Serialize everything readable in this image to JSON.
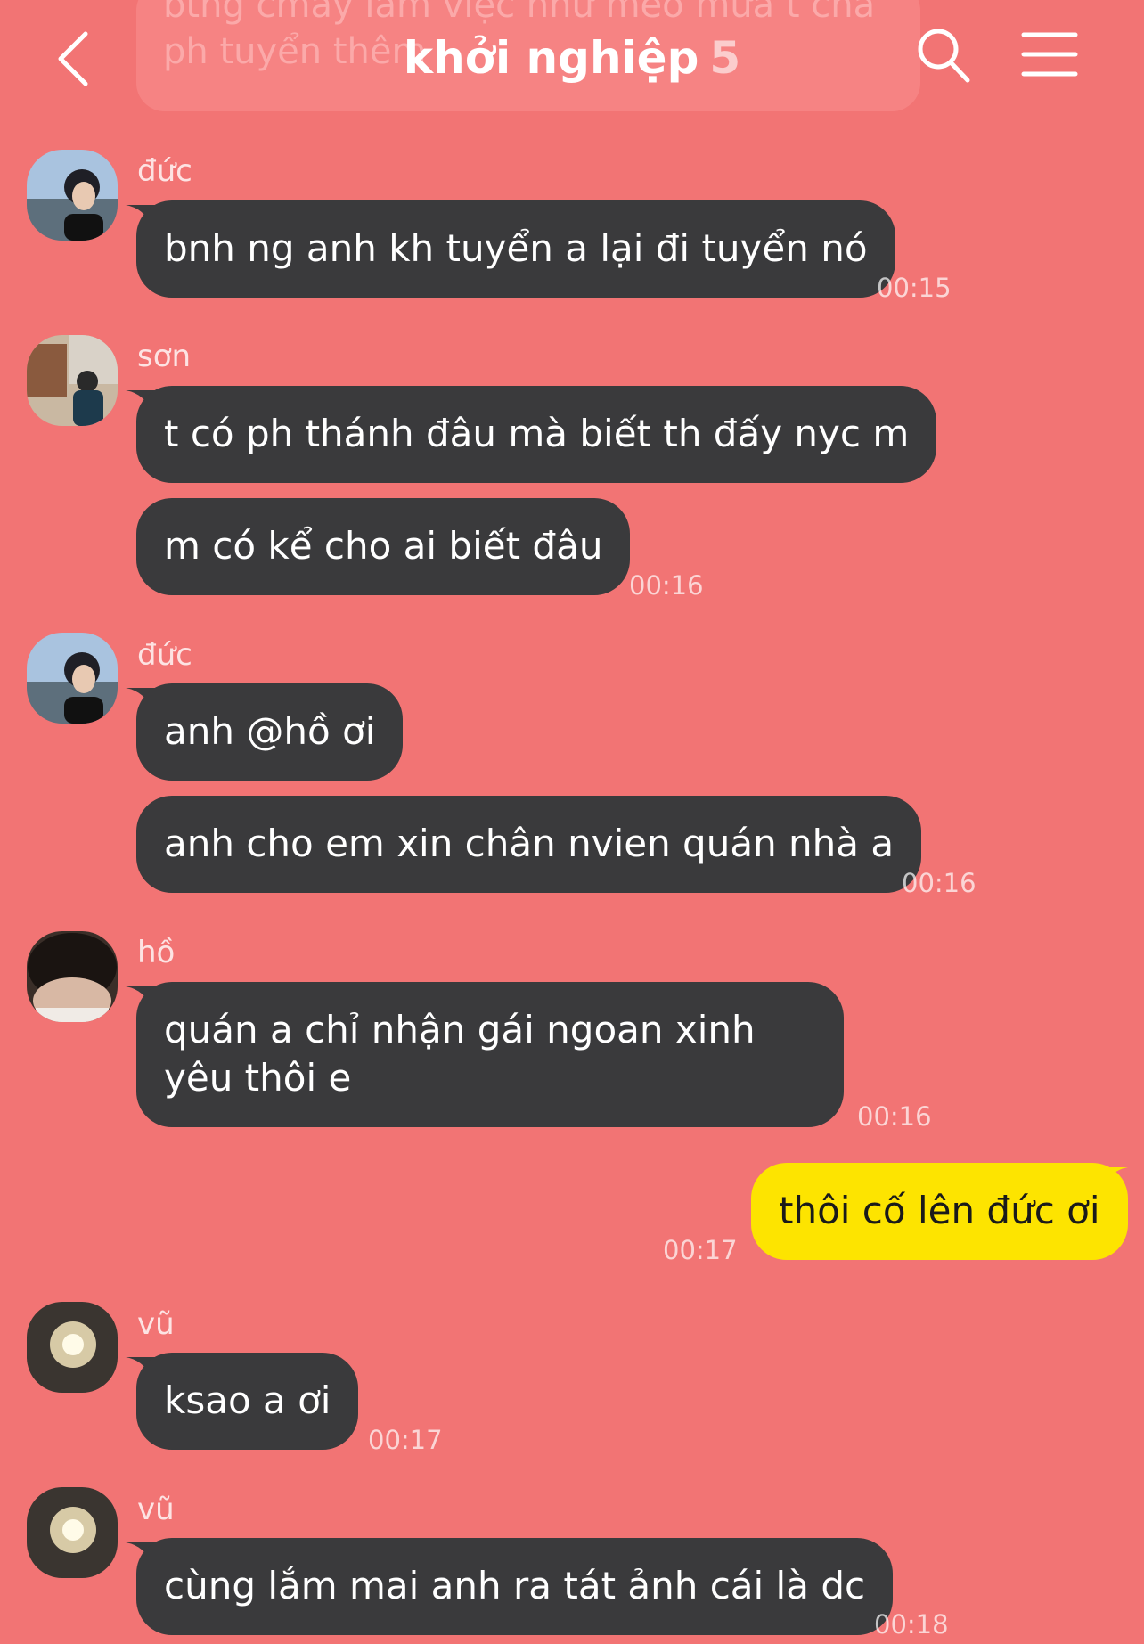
{
  "header": {
    "title": "khởi nghiệp",
    "member_count": "5"
  },
  "icons": {
    "back": "chevron-left-icon",
    "search": "search-icon",
    "menu": "hamburger-menu-icon"
  },
  "colors": {
    "background": "#f27474",
    "bubble_other": "#3a3a3c",
    "bubble_mine": "#fde400"
  },
  "previous_message": {
    "line1": "bthg cmay làm việc như mèo mửa t chả",
    "line2": "ph tuyển thêm"
  },
  "messages": [
    {
      "sender": "đức",
      "texts": [
        "bnh ng anh kh tuyển a lại đi tuyển nó"
      ],
      "time": "00:15"
    },
    {
      "sender": "sơn",
      "texts": [
        "t có ph thánh đâu mà biết th đấy nyc m",
        "m có kể cho ai biết đâu"
      ],
      "time": "00:16"
    },
    {
      "sender": "đức",
      "texts": [
        "anh @hồ ơi",
        "anh cho em xin chân nvien quán nhà a"
      ],
      "time": "00:16"
    },
    {
      "sender": "hồ",
      "texts": [
        "quán a chỉ nhận gái ngoan xinh yêu thôi e"
      ],
      "time": "00:16"
    },
    {
      "sender": "me",
      "texts": [
        "thôi cố lên đức ơi"
      ],
      "time": "00:17"
    },
    {
      "sender": "vũ",
      "texts": [
        "ksao a ơi"
      ],
      "time": "00:17"
    },
    {
      "sender": "vũ",
      "texts": [
        "cùng lắm mai anh ra tát ảnh cái là dc"
      ],
      "time": "00:18"
    }
  ]
}
